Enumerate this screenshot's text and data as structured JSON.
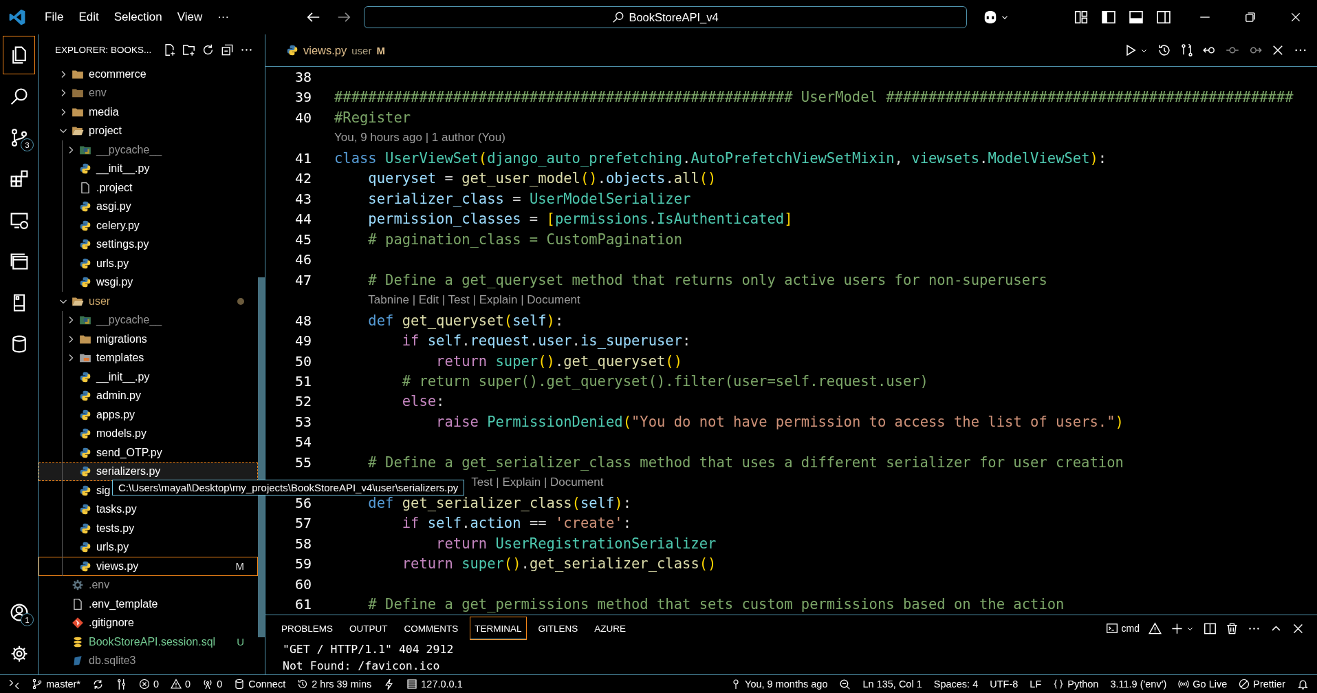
{
  "title_bar": {
    "menu": [
      "File",
      "Edit",
      "Selection",
      "View",
      "···"
    ],
    "nav": [
      {
        "kind": "back",
        "disabled": false
      },
      {
        "kind": "forward",
        "disabled": true
      }
    ],
    "search": "BookStoreAPI_v4",
    "tools": [
      {
        "kind": "copilot"
      },
      {
        "kind": "dropdown"
      }
    ],
    "layout": [
      {
        "kind": "layout"
      },
      {
        "kind": "sidebar_left"
      },
      {
        "kind": "panel_bottom"
      },
      {
        "kind": "sidebar_right"
      }
    ],
    "window": [
      {
        "kind": "minimize"
      },
      {
        "kind": "restore"
      },
      {
        "kind": "close"
      }
    ]
  },
  "activity_bar": {
    "items": [
      {
        "kind": "explorer",
        "selected": true
      },
      {
        "kind": "search",
        "selected": false
      },
      {
        "kind": "source_control",
        "selected": false,
        "badge": "3"
      },
      {
        "kind": "extensions",
        "selected": false
      },
      {
        "kind": "remote_explorer",
        "selected": false
      },
      {
        "kind": "panels",
        "selected": false
      },
      {
        "kind": "device",
        "selected": false
      },
      {
        "kind": "database",
        "selected": false
      }
    ],
    "bottom": [
      {
        "kind": "accounts",
        "badge": "1"
      },
      {
        "kind": "manage"
      }
    ]
  },
  "sidebar": {
    "title": "EXPLORER: BOOKS...",
    "actions": [
      {
        "kind": "new_file"
      },
      {
        "kind": "new_folder"
      },
      {
        "kind": "refresh"
      },
      {
        "kind": "collapse"
      },
      {
        "kind": "more"
      }
    ],
    "tree": [
      {
        "name": "ecommerce",
        "kind": "folder",
        "expanded": false,
        "selected": false,
        "hovered": false,
        "ignored": false,
        "modified": false
      },
      {
        "name": "env",
        "kind": "folder",
        "expanded": false,
        "selected": false,
        "hovered": false,
        "ignored": true,
        "modified": false
      },
      {
        "name": "media",
        "kind": "folder",
        "expanded": false,
        "selected": false,
        "hovered": false,
        "ignored": false,
        "modified": false
      },
      {
        "name": "project",
        "kind": "folder",
        "expanded": true,
        "selected": false,
        "hovered": false,
        "ignored": false,
        "modified": false,
        "children": [
          {
            "name": "__pycache__",
            "kind": "pycache",
            "expanded": false,
            "selected": false,
            "hovered": false,
            "ignored": true,
            "modified": false
          },
          {
            "name": "__init__.py",
            "kind": "python",
            "selected": false,
            "hovered": false,
            "ignored": false,
            "modified": false
          },
          {
            "name": ".project",
            "kind": "file",
            "selected": false,
            "hovered": false,
            "ignored": false,
            "modified": false
          },
          {
            "name": "asgi.py",
            "kind": "python",
            "selected": false,
            "hovered": false,
            "ignored": false,
            "modified": false
          },
          {
            "name": "celery.py",
            "kind": "python",
            "selected": false,
            "hovered": false,
            "ignored": false,
            "modified": false
          },
          {
            "name": "settings.py",
            "kind": "python",
            "selected": false,
            "hovered": false,
            "ignored": false,
            "modified": false
          },
          {
            "name": "urls.py",
            "kind": "python",
            "selected": false,
            "hovered": false,
            "ignored": false,
            "modified": false
          },
          {
            "name": "wsgi.py",
            "kind": "python",
            "selected": false,
            "hovered": false,
            "ignored": false,
            "modified": false
          }
        ]
      },
      {
        "name": "user",
        "kind": "folder",
        "expanded": true,
        "selected": false,
        "hovered": false,
        "ignored": false,
        "modified": true,
        "children": [
          {
            "name": "__pycache__",
            "kind": "pycache",
            "expanded": false,
            "selected": false,
            "hovered": false,
            "ignored": true,
            "modified": false
          },
          {
            "name": "migrations",
            "kind": "folder",
            "expanded": false,
            "selected": false,
            "hovered": false,
            "ignored": false,
            "modified": false
          },
          {
            "name": "templates",
            "kind": "templates",
            "expanded": false,
            "selected": false,
            "hovered": false,
            "ignored": false,
            "modified": false
          },
          {
            "name": "__init__.py",
            "kind": "python",
            "selected": false,
            "hovered": false,
            "ignored": false,
            "modified": false
          },
          {
            "name": "admin.py",
            "kind": "python",
            "selected": false,
            "hovered": false,
            "ignored": false,
            "modified": false
          },
          {
            "name": "apps.py",
            "kind": "python",
            "selected": false,
            "hovered": false,
            "ignored": false,
            "modified": false
          },
          {
            "name": "models.py",
            "kind": "python",
            "selected": false,
            "hovered": false,
            "ignored": false,
            "modified": false
          },
          {
            "name": "send_OTP.py",
            "kind": "python",
            "selected": false,
            "hovered": false,
            "ignored": false,
            "modified": false
          },
          {
            "name": "serializers.py",
            "kind": "python",
            "selected": false,
            "hovered": true,
            "ignored": false,
            "modified": false
          },
          {
            "name": "sig",
            "kind": "python",
            "selected": false,
            "hovered": false,
            "ignored": false,
            "modified": false
          },
          {
            "name": "tasks.py",
            "kind": "python",
            "selected": false,
            "hovered": false,
            "ignored": false,
            "modified": false
          },
          {
            "name": "tests.py",
            "kind": "python",
            "selected": false,
            "hovered": false,
            "ignored": false,
            "modified": false
          },
          {
            "name": "urls.py",
            "kind": "python",
            "selected": false,
            "hovered": false,
            "ignored": false,
            "modified": false
          },
          {
            "name": "views.py",
            "kind": "python",
            "selected": true,
            "hovered": false,
            "ignored": false,
            "modified": false,
            "status": "M"
          }
        ]
      },
      {
        "name": ".env",
        "kind": "env",
        "selected": false,
        "hovered": false,
        "ignored": true,
        "modified": false
      },
      {
        "name": ".env_template",
        "kind": "file",
        "selected": false,
        "hovered": false,
        "ignored": false,
        "modified": false
      },
      {
        "name": ".gitignore",
        "kind": "git",
        "selected": false,
        "hovered": false,
        "ignored": false,
        "modified": false
      },
      {
        "name": "BookStoreAPI.session.sql",
        "kind": "sql",
        "selected": false,
        "hovered": false,
        "ignored": false,
        "modified": false,
        "status": "U"
      },
      {
        "name": "db.sqlite3",
        "kind": "sqlite",
        "selected": false,
        "hovered": false,
        "ignored": true,
        "modified": false
      }
    ]
  },
  "editor": {
    "tab": {
      "name": "views.py",
      "folder": "user",
      "status": "M"
    },
    "actions": [
      {
        "kind": "run",
        "disabled": false
      },
      {
        "kind": "dropdown",
        "disabled": false
      },
      {
        "kind": "history",
        "disabled": false
      },
      {
        "kind": "compare",
        "disabled": false
      },
      {
        "kind": "commit_back",
        "disabled": false
      },
      {
        "kind": "commit",
        "disabled": true
      },
      {
        "kind": "commit_forward",
        "disabled": true
      },
      {
        "kind": "close",
        "disabled": false
      },
      {
        "kind": "more",
        "disabled": false
      }
    ],
    "rows": [
      {
        "kind": "code",
        "number": "38"
      },
      {
        "kind": "code",
        "number": "39",
        "tokens": [
          {
            "kind": "cm",
            "text": "###################################################### UserModel ################################################"
          }
        ]
      },
      {
        "kind": "code",
        "number": "40",
        "tokens": [
          {
            "kind": "cm",
            "text": "#Register"
          }
        ]
      },
      {
        "kind": "lens",
        "text": "You, 9 hours ago | 1 author (You)"
      },
      {
        "kind": "code",
        "number": "41",
        "tokens": [
          {
            "kind": "kw",
            "text": "class "
          },
          {
            "kind": "cls",
            "text": "UserViewSet"
          },
          {
            "kind": "b1",
            "text": "("
          },
          {
            "kind": "cls",
            "text": "django_auto_prefetching"
          },
          {
            "kind": "p",
            "text": "."
          },
          {
            "kind": "cls",
            "text": "AutoPrefetchViewSetMixin"
          },
          {
            "kind": "p",
            "text": ", "
          },
          {
            "kind": "cls",
            "text": "viewsets"
          },
          {
            "kind": "p",
            "text": "."
          },
          {
            "kind": "cls",
            "text": "ModelViewSet"
          },
          {
            "kind": "b1",
            "text": ")"
          },
          {
            "kind": "p",
            "text": ":"
          }
        ]
      },
      {
        "kind": "code",
        "number": "42",
        "tokens": [
          {
            "kind": "var",
            "text": "    queryset"
          },
          {
            "kind": "p",
            "text": " = "
          },
          {
            "kind": "fn",
            "text": "get_user_model"
          },
          {
            "kind": "b1",
            "text": "()"
          },
          {
            "kind": "p",
            "text": "."
          },
          {
            "kind": "var",
            "text": "objects"
          },
          {
            "kind": "p",
            "text": "."
          },
          {
            "kind": "fn",
            "text": "all"
          },
          {
            "kind": "b1",
            "text": "()"
          }
        ]
      },
      {
        "kind": "code",
        "number": "43",
        "tokens": [
          {
            "kind": "var",
            "text": "    serializer_class"
          },
          {
            "kind": "p",
            "text": " = "
          },
          {
            "kind": "cls",
            "text": "UserModelSerializer"
          }
        ]
      },
      {
        "kind": "code",
        "number": "44",
        "tokens": [
          {
            "kind": "var",
            "text": "    permission_classes"
          },
          {
            "kind": "p",
            "text": " = "
          },
          {
            "kind": "b1",
            "text": "["
          },
          {
            "kind": "cls",
            "text": "permissions"
          },
          {
            "kind": "p",
            "text": "."
          },
          {
            "kind": "cls",
            "text": "IsAuthenticated"
          },
          {
            "kind": "b1",
            "text": "]"
          }
        ]
      },
      {
        "kind": "code",
        "number": "45",
        "tokens": [
          {
            "kind": "cm",
            "text": "    # pagination_class = CustomPagination"
          }
        ]
      },
      {
        "kind": "code",
        "number": "46"
      },
      {
        "kind": "code",
        "number": "47",
        "tokens": [
          {
            "kind": "cm",
            "text": "    # Define a get_queryset method that returns only active users for non-superusers"
          }
        ]
      },
      {
        "kind": "lens",
        "text": "Tabnine | Edit | Test | Explain | Document"
      },
      {
        "kind": "code",
        "number": "48",
        "tokens": [
          {
            "kind": "kw",
            "text": "    def "
          },
          {
            "kind": "fn",
            "text": "get_queryset"
          },
          {
            "kind": "b1",
            "text": "("
          },
          {
            "kind": "var",
            "text": "self"
          },
          {
            "kind": "b1",
            "text": ")"
          },
          {
            "kind": "p",
            "text": ":"
          }
        ]
      },
      {
        "kind": "code",
        "number": "49",
        "tokens": [
          {
            "kind": "ctl",
            "text": "        if "
          },
          {
            "kind": "var",
            "text": "self"
          },
          {
            "kind": "p",
            "text": "."
          },
          {
            "kind": "var",
            "text": "request"
          },
          {
            "kind": "p",
            "text": "."
          },
          {
            "kind": "var",
            "text": "user"
          },
          {
            "kind": "p",
            "text": "."
          },
          {
            "kind": "var",
            "text": "is_superuser"
          },
          {
            "kind": "p",
            "text": ":"
          }
        ]
      },
      {
        "kind": "code",
        "number": "50",
        "tokens": [
          {
            "kind": "ctl",
            "text": "            return "
          },
          {
            "kind": "cls",
            "text": "super"
          },
          {
            "kind": "b1",
            "text": "()"
          },
          {
            "kind": "p",
            "text": "."
          },
          {
            "kind": "fn",
            "text": "get_queryset"
          },
          {
            "kind": "b1",
            "text": "()"
          }
        ]
      },
      {
        "kind": "code",
        "number": "51",
        "tokens": [
          {
            "kind": "cm",
            "text": "        # return super().get_queryset().filter(user=self.request.user)"
          }
        ]
      },
      {
        "kind": "code",
        "number": "52",
        "tokens": [
          {
            "kind": "ctl",
            "text": "        else"
          },
          {
            "kind": "p",
            "text": ":"
          }
        ]
      },
      {
        "kind": "code",
        "number": "53",
        "tokens": [
          {
            "kind": "ctl",
            "text": "            raise "
          },
          {
            "kind": "cls",
            "text": "PermissionDenied"
          },
          {
            "kind": "b1",
            "text": "("
          },
          {
            "kind": "str",
            "text": "\"You do not have permission to access the list of users.\""
          },
          {
            "kind": "b1",
            "text": ")"
          }
        ]
      },
      {
        "kind": "code",
        "number": "54"
      },
      {
        "kind": "code",
        "number": "55",
        "tokens": [
          {
            "kind": "cm",
            "text": "    # Define a get_serializer_class method that uses a different serializer for user creation"
          }
        ]
      },
      {
        "kind": "lens",
        "text": "Test | Explain | Document",
        "tooltip": "C:\\Users\\mayal\\Desktop\\my_projects\\BookStoreAPI_v4\\user\\serializers.py"
      },
      {
        "kind": "code",
        "number": "56",
        "tokens": [
          {
            "kind": "kw",
            "text": "    def "
          },
          {
            "kind": "fn",
            "text": "get_serializer_class"
          },
          {
            "kind": "b1",
            "text": "("
          },
          {
            "kind": "var",
            "text": "self"
          },
          {
            "kind": "b1",
            "text": ")"
          },
          {
            "kind": "p",
            "text": ":"
          }
        ]
      },
      {
        "kind": "code",
        "number": "57",
        "tokens": [
          {
            "kind": "ctl",
            "text": "        if "
          },
          {
            "kind": "var",
            "text": "self"
          },
          {
            "kind": "p",
            "text": "."
          },
          {
            "kind": "var",
            "text": "action"
          },
          {
            "kind": "p",
            "text": " == "
          },
          {
            "kind": "str",
            "text": "'create'"
          },
          {
            "kind": "p",
            "text": ":"
          }
        ]
      },
      {
        "kind": "code",
        "number": "58",
        "tokens": [
          {
            "kind": "ctl",
            "text": "            return "
          },
          {
            "kind": "cls",
            "text": "UserRegistrationSerializer"
          }
        ]
      },
      {
        "kind": "code",
        "number": "59",
        "tokens": [
          {
            "kind": "ctl",
            "text": "        return "
          },
          {
            "kind": "cls",
            "text": "super"
          },
          {
            "kind": "b1",
            "text": "()"
          },
          {
            "kind": "p",
            "text": "."
          },
          {
            "kind": "fn",
            "text": "get_serializer_class"
          },
          {
            "kind": "b1",
            "text": "()"
          }
        ]
      },
      {
        "kind": "code",
        "number": "60"
      },
      {
        "kind": "code",
        "number": "61",
        "tokens": [
          {
            "kind": "cm",
            "text": "    # Define a get_permissions method that sets custom permissions based on the action"
          }
        ]
      }
    ]
  },
  "panel": {
    "tabs": [
      {
        "label": "PROBLEMS",
        "selected": false
      },
      {
        "label": "OUTPUT",
        "selected": false
      },
      {
        "label": "COMMENTS",
        "selected": false
      },
      {
        "label": "TERMINAL",
        "selected": true
      },
      {
        "label": "GITLENS",
        "selected": false
      },
      {
        "label": "AZURE",
        "selected": false
      }
    ],
    "shell": "cmd",
    "actions": [
      {
        "kind": "warning"
      },
      {
        "kind": "add"
      },
      {
        "kind": "dropdown"
      },
      {
        "kind": "split"
      },
      {
        "kind": "trash"
      },
      {
        "kind": "more"
      },
      {
        "kind": "maximize"
      },
      {
        "kind": "close"
      }
    ],
    "lines": [
      "\"GET / HTTP/1.1\" 404 2912",
      "Not Found: /favicon.ico"
    ]
  },
  "status_bar": {
    "left": [
      {
        "kind": "remote"
      },
      {
        "kind": "branch",
        "text": "master*"
      },
      {
        "kind": "sync"
      },
      {
        "kind": "graph"
      },
      {
        "kind": "error",
        "text": "0"
      },
      {
        "kind": "warning",
        "text": "0"
      },
      {
        "kind": "broadcast",
        "text": "0"
      },
      {
        "kind": "database",
        "text": "Connect"
      },
      {
        "kind": "history",
        "text": "2 hrs 39 mins"
      },
      {
        "kind": "bolt"
      },
      {
        "kind": "server",
        "text": "127.0.0.1"
      }
    ],
    "right": [
      {
        "kind": "pin",
        "text": "You, 9 months ago"
      },
      {
        "kind": "zoom"
      },
      {
        "text": "Ln 135, Col 1"
      },
      {
        "text": "Spaces: 4"
      },
      {
        "text": "UTF-8"
      },
      {
        "text": "LF"
      },
      {
        "kind": "braces",
        "text": "Python"
      },
      {
        "text": "3.11.9 ('env')"
      },
      {
        "kind": "golive",
        "text": "Go Live"
      },
      {
        "kind": "prettier",
        "text": "Prettier"
      },
      {
        "kind": "bell"
      }
    ]
  }
}
